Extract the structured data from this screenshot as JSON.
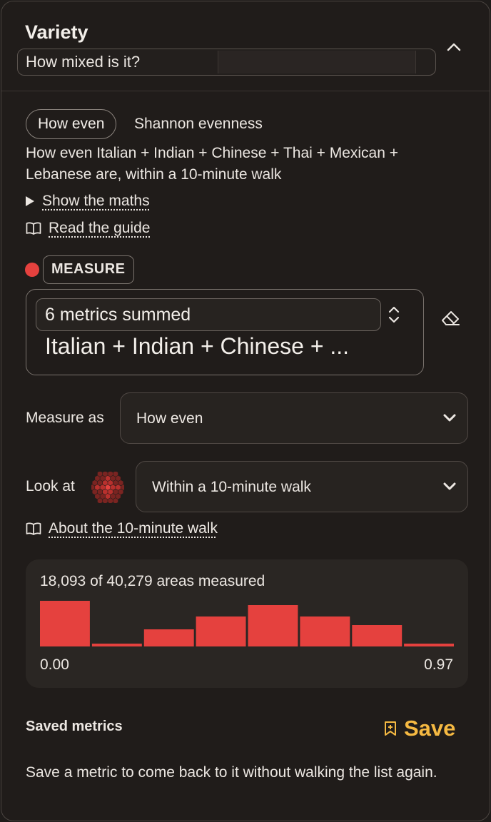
{
  "header": {
    "title": "Variety",
    "subtitle": "How mixed is it?",
    "collapse_icon": "chevron-up-icon"
  },
  "metric_type": {
    "chip_label": "How even",
    "name": "Shannon evenness",
    "description": "How even Italian + Indian + Chinese + Thai + Mexican + Lebanese are, within a 10-minute walk"
  },
  "links": {
    "show_maths": "Show the maths",
    "read_guide": "Read the guide",
    "about_walk": "About the 10-minute walk"
  },
  "measure": {
    "tag": "MEASURE",
    "dot_color": "#e5413e",
    "summary": "6 metrics summed",
    "list": "Italian + Indian + Chinese + ...",
    "clear_icon": "eraser-icon"
  },
  "measure_as": {
    "label": "Measure as",
    "value": "How even"
  },
  "look_at": {
    "label": "Look at",
    "value": "Within a 10-minute walk"
  },
  "stats": {
    "count_text": "18,093 of 40,279 areas measured",
    "min_label": "0.00",
    "max_label": "0.97"
  },
  "chart_data": {
    "type": "bar",
    "categories": [
      "1",
      "2",
      "3",
      "4",
      "5",
      "6",
      "7",
      "8"
    ],
    "values": [
      64,
      4,
      24,
      42,
      58,
      42,
      30,
      4
    ],
    "xlim": [
      0.0,
      0.97
    ],
    "color": "#e5413e",
    "title": "",
    "xlabel": "",
    "ylabel": "",
    "grid": false
  },
  "saved": {
    "label": "Saved metrics",
    "button": "Save",
    "button_color": "#f5b942",
    "note": "Save a metric to come back to it without walking the list again."
  }
}
